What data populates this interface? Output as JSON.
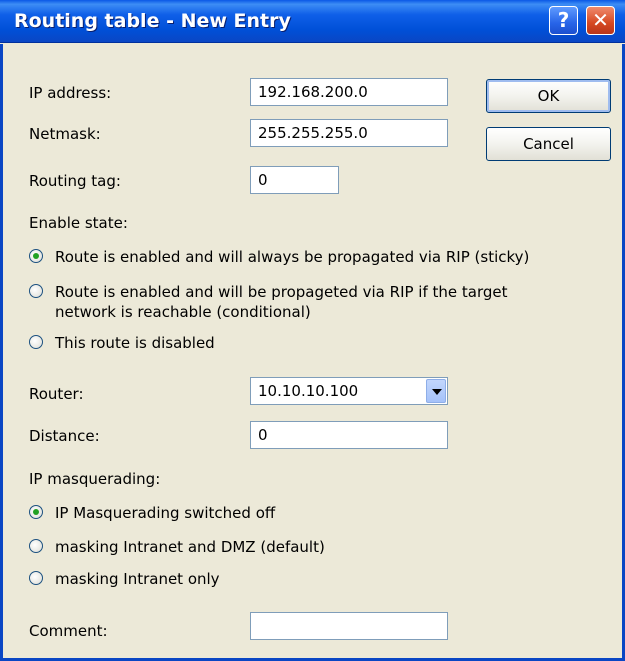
{
  "window": {
    "title": "Routing table - New Entry",
    "help_label": "?",
    "close_label": "✕"
  },
  "buttons": {
    "ok": "OK",
    "cancel": "Cancel"
  },
  "fields": {
    "ip_address": {
      "label": "IP address:",
      "value": "192.168.200.0"
    },
    "netmask": {
      "label": "Netmask:",
      "value": "255.255.255.0"
    },
    "routing_tag": {
      "label": "Routing tag:",
      "value": "0"
    },
    "router": {
      "label": "Router:",
      "value": "10.10.10.100"
    },
    "distance": {
      "label": "Distance:",
      "value": "0"
    },
    "comment": {
      "label": "Comment:",
      "value": ""
    }
  },
  "enable_state": {
    "heading": "Enable state:",
    "options": [
      {
        "line1": "Route is enabled and will always be propagated via RIP (sticky)",
        "line2": "",
        "checked": true
      },
      {
        "line1": "Route is enabled and will be propageted via RIP if the target",
        "line2": "network is reachable (conditional)",
        "checked": false
      },
      {
        "line1": "This route is disabled",
        "line2": "",
        "checked": false
      }
    ]
  },
  "masquerading": {
    "heading": "IP masquerading:",
    "options": [
      {
        "label": "IP Masquerading switched off",
        "checked": true
      },
      {
        "label": "masking Intranet and DMZ (default)",
        "checked": false
      },
      {
        "label": "masking Intranet only",
        "checked": false
      }
    ]
  }
}
